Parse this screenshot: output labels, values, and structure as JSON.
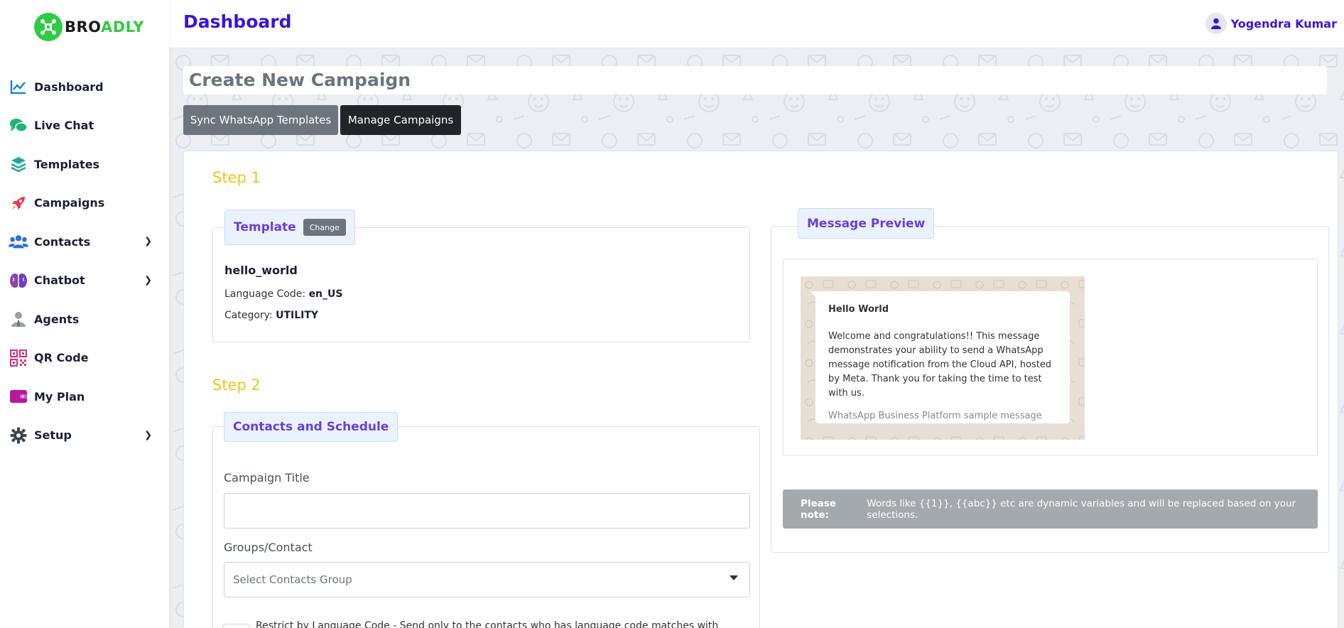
{
  "brand": {
    "name_part1": "BRO",
    "name_part2": "ADLY",
    "color_green": "#2ecc40"
  },
  "header": {
    "title": "Dashboard",
    "user_name": "Yogendra Kumar",
    "accent": "#3b14d9"
  },
  "sidebar": {
    "items": [
      {
        "label": "Dashboard",
        "icon": "chart-line-icon"
      },
      {
        "label": "Live Chat",
        "icon": "chat-bubbles-icon"
      },
      {
        "label": "Templates",
        "icon": "layers-icon"
      },
      {
        "label": "Campaigns",
        "icon": "rocket-icon"
      },
      {
        "label": "Contacts",
        "icon": "users-icon",
        "has_submenu": true
      },
      {
        "label": "Chatbot",
        "icon": "brain-icon",
        "has_submenu": true
      },
      {
        "label": "Agents",
        "icon": "agent-icon"
      },
      {
        "label": "QR Code",
        "icon": "qr-code-icon"
      },
      {
        "label": "My Plan",
        "icon": "wallet-icon"
      },
      {
        "label": "Setup",
        "icon": "gear-icon",
        "has_submenu": true
      }
    ]
  },
  "main": {
    "campaign_title": "Create New Campaign",
    "buttons": {
      "sync": "Sync WhatsApp Templates",
      "manage": "Manage Campaigns"
    },
    "step1": {
      "heading": "Step 1",
      "template_legend": "Template",
      "change_label": "Change",
      "template_name": "hello_world",
      "language_label": "Language Code:",
      "language_value": "en_US",
      "category_label": "Category:",
      "category_value": "UTILITY"
    },
    "step2": {
      "heading": "Step 2",
      "legend": "Contacts and Schedule",
      "campaign_title_label": "Campaign Title",
      "campaign_title_value": "",
      "groups_label": "Groups/Contact",
      "groups_placeholder": "Select Contacts Group",
      "restrict_text": "Restrict by Language Code - Send only to the contacts who has language code matches with"
    },
    "preview": {
      "legend": "Message Preview",
      "header": "Hello World",
      "body": "Welcome and congratulations!! This message demonstrates your ability to send a WhatsApp message notification from the Cloud API, hosted by Meta. Thank you for taking the time to test with us.",
      "footer": "WhatsApp Business Platform sample message"
    },
    "note": {
      "bold": "Please note:",
      "text": "Words like {{1}}, {{abc}} etc are dynamic variables and will be replaced based on your selections."
    }
  }
}
